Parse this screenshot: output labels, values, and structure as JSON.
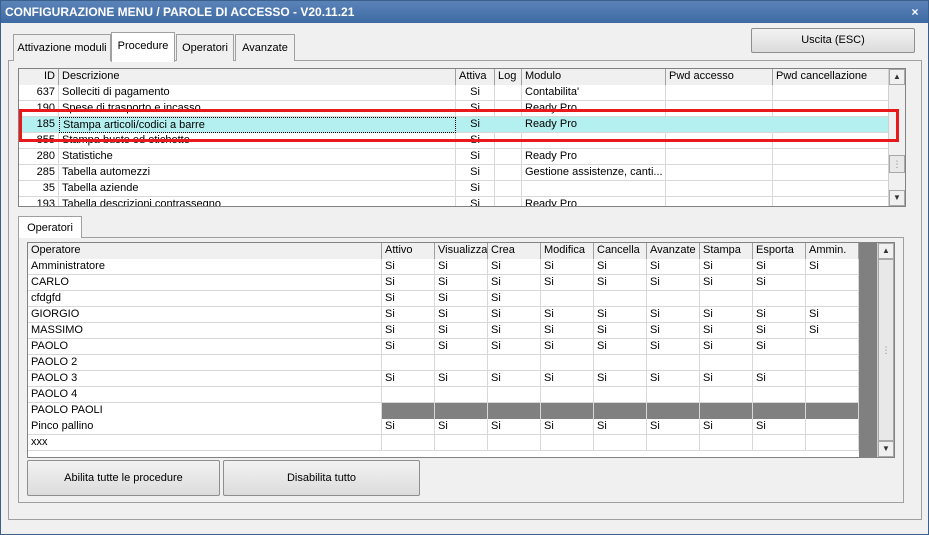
{
  "window": {
    "title": "CONFIGURAZIONE MENU / PAROLE DI ACCESSO - V20.11.21",
    "close_glyph": "×"
  },
  "tabs": [
    "Attivazione moduli",
    "Procedure",
    "Operatori",
    "Avanzate"
  ],
  "exit_button": "Uscita (ESC)",
  "procedures": {
    "columns": [
      "ID",
      "Descrizione",
      "Attiva",
      "Log",
      "Modulo",
      "Pwd accesso",
      "Pwd cancellazione"
    ],
    "rows": [
      {
        "id": "637",
        "desc": "Solleciti di pagamento",
        "attiva": "Si",
        "log": "",
        "modulo": "Contabilita'"
      },
      {
        "id": "190",
        "desc": "Spese di trasporto e incasso",
        "attiva": "Si",
        "log": "",
        "modulo": "Ready Pro"
      },
      {
        "id": "185",
        "desc": "Stampa articoli/codici a barre",
        "attiva": "Si",
        "log": "",
        "modulo": "Ready Pro",
        "selected": true
      },
      {
        "id": "855",
        "desc": "Stampa buste ed etichette",
        "attiva": "Si",
        "log": "",
        "modulo": ""
      },
      {
        "id": "280",
        "desc": "Statistiche",
        "attiva": "Si",
        "log": "",
        "modulo": "Ready Pro"
      },
      {
        "id": "285",
        "desc": "Tabella automezzi",
        "attiva": "Si",
        "log": "",
        "modulo": "Gestione assistenze, canti..."
      },
      {
        "id": "35",
        "desc": "Tabella aziende",
        "attiva": "Si",
        "log": "",
        "modulo": ""
      },
      {
        "id": "193",
        "desc": "Tabella descrizioni contrassegno",
        "attiva": "Si",
        "log": "",
        "modulo": "Ready Pro"
      }
    ]
  },
  "subtab": "Operatori",
  "operators": {
    "columns": [
      "Operatore",
      "Attivo",
      "Visualizza",
      "Crea",
      "Modifica",
      "Cancella",
      "Avanzate",
      "Stampa",
      "Esporta",
      "Ammin."
    ],
    "rows": [
      {
        "name": "Amministratore",
        "v": [
          "Si",
          "Si",
          "Si",
          "Si",
          "Si",
          "Si",
          "Si",
          "Si",
          "Si"
        ]
      },
      {
        "name": "CARLO",
        "v": [
          "Si",
          "Si",
          "Si",
          "Si",
          "Si",
          "Si",
          "Si",
          "Si",
          ""
        ]
      },
      {
        "name": "cfdgfd",
        "v": [
          "Si",
          "Si",
          "Si",
          "",
          "",
          "",
          "",
          "",
          ""
        ]
      },
      {
        "name": "GIORGIO",
        "v": [
          "Si",
          "Si",
          "Si",
          "Si",
          "Si",
          "Si",
          "Si",
          "Si",
          "Si"
        ]
      },
      {
        "name": "MASSIMO",
        "v": [
          "Si",
          "Si",
          "Si",
          "Si",
          "Si",
          "Si",
          "Si",
          "Si",
          "Si"
        ]
      },
      {
        "name": "PAOLO",
        "v": [
          "Si",
          "Si",
          "Si",
          "Si",
          "Si",
          "Si",
          "Si",
          "Si",
          ""
        ]
      },
      {
        "name": "PAOLO 2",
        "v": [
          "",
          "",
          "",
          "",
          "",
          "",
          "",
          "",
          ""
        ]
      },
      {
        "name": "PAOLO 3",
        "v": [
          "Si",
          "Si",
          "Si",
          "Si",
          "Si",
          "Si",
          "Si",
          "Si",
          ""
        ]
      },
      {
        "name": "PAOLO 4",
        "v": [
          "",
          "",
          "",
          "",
          "",
          "",
          "",
          "",
          ""
        ]
      },
      {
        "name": "PAOLO PAOLI",
        "v": [
          "",
          "",
          "",
          "",
          "",
          "",
          "",
          "",
          ""
        ],
        "grey": true
      },
      {
        "name": "Pinco pallino",
        "v": [
          "Si",
          "Si",
          "Si",
          "Si",
          "Si",
          "Si",
          "Si",
          "Si",
          ""
        ]
      },
      {
        "name": "xxx",
        "v": [
          "",
          "",
          "",
          "",
          "",
          "",
          "",
          "",
          ""
        ]
      }
    ]
  },
  "buttons": {
    "enable_all": "Abilita tutte le procedure",
    "disable_all": "Disabilita tutto"
  },
  "icons": {
    "scroll_up": "▲",
    "scroll_down": "▼",
    "grip": "⋮"
  },
  "colors": {
    "title_bar": "#3e6aa4",
    "selected_row": "#b4f0f0",
    "highlight_box": "#e8181b",
    "grey_row": "#808080"
  }
}
